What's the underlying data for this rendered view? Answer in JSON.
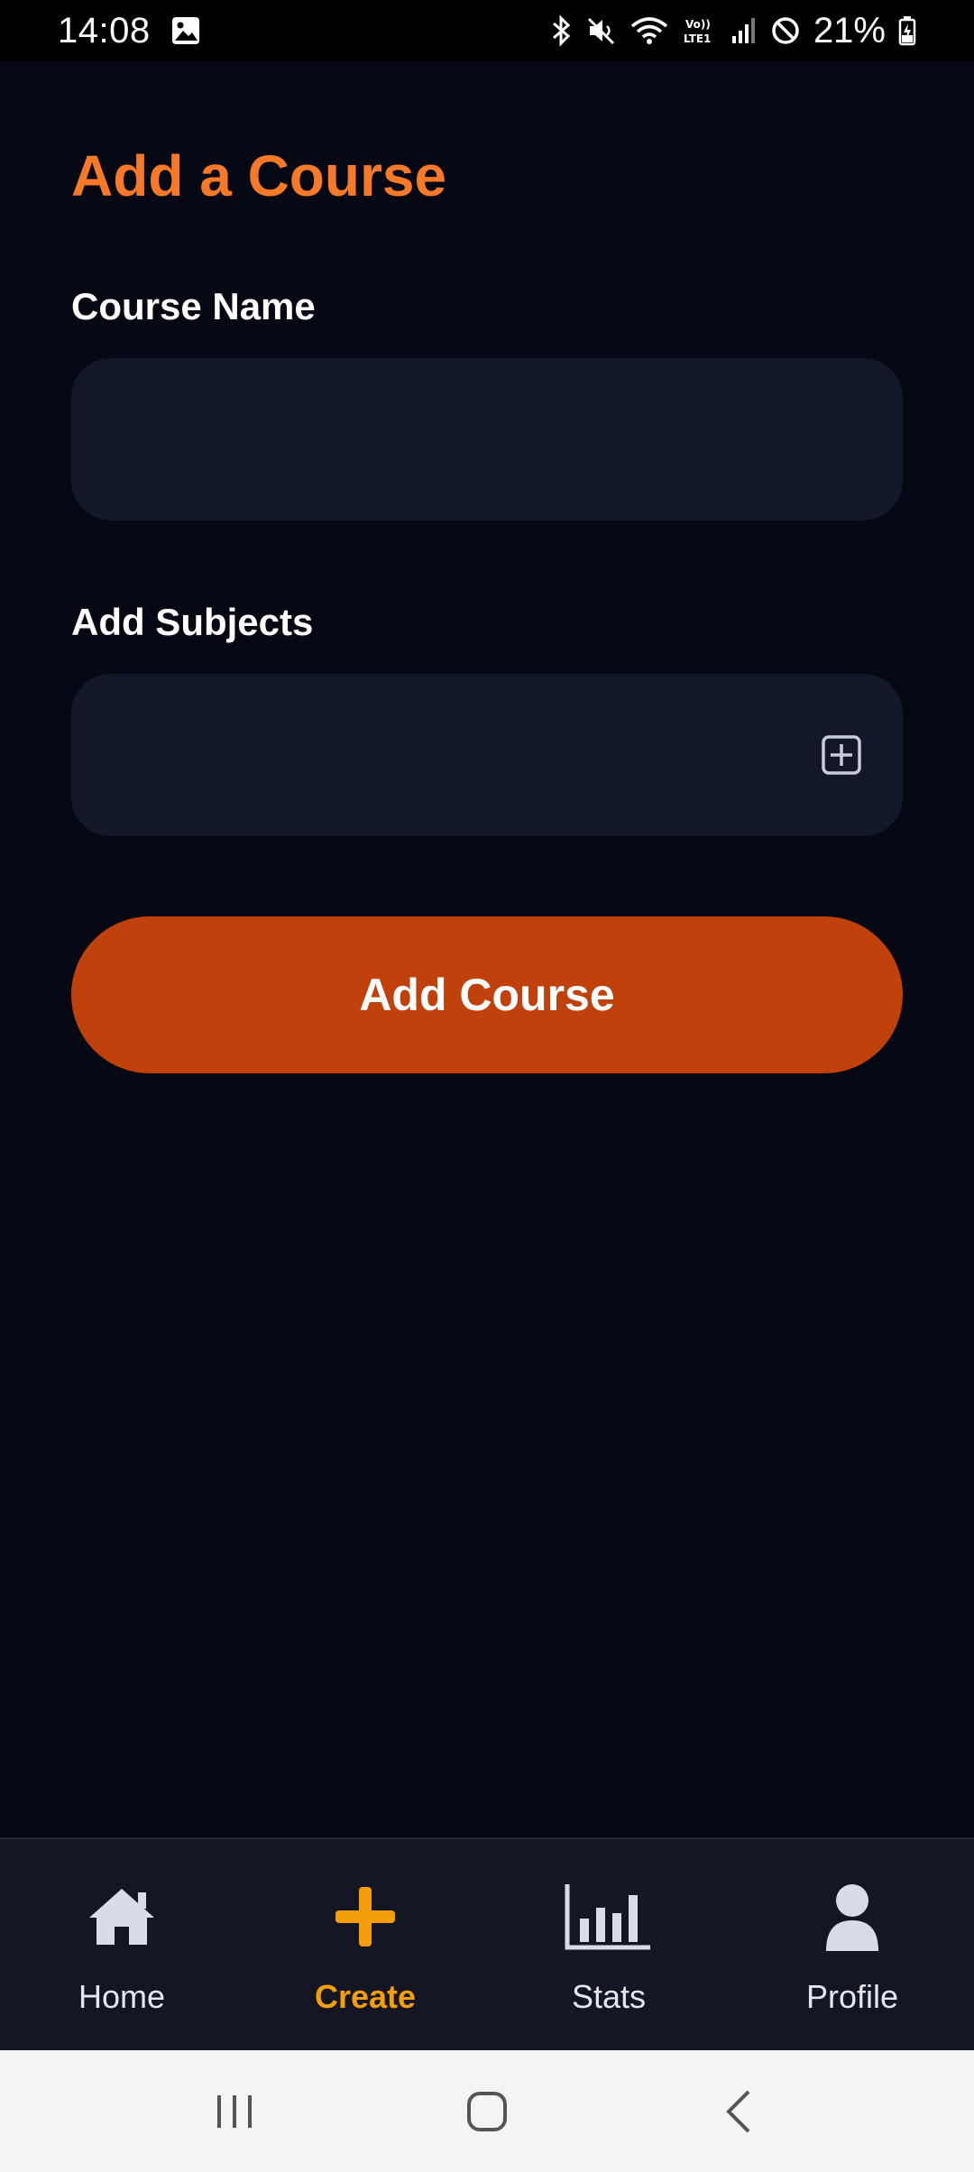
{
  "status_bar": {
    "time": "14:08",
    "battery": "21%"
  },
  "page": {
    "title": "Add a Course"
  },
  "form": {
    "course_name_label": "Course Name",
    "course_name_value": "",
    "subjects_label": "Add Subjects",
    "subjects_value": "",
    "submit_label": "Add Course"
  },
  "bottom_nav": {
    "items": [
      {
        "label": "Home",
        "icon": "home-icon",
        "active": false
      },
      {
        "label": "Create",
        "icon": "plus-icon",
        "active": true
      },
      {
        "label": "Stats",
        "icon": "bar-chart-icon",
        "active": false
      },
      {
        "label": "Profile",
        "icon": "person-icon",
        "active": false
      }
    ]
  },
  "colors": {
    "background": "#060913",
    "accent_title": "#f6792a",
    "button": "#c1410c",
    "input_bg": "#121829",
    "nav_active": "#f59e0b",
    "nav_bg": "#141622"
  }
}
